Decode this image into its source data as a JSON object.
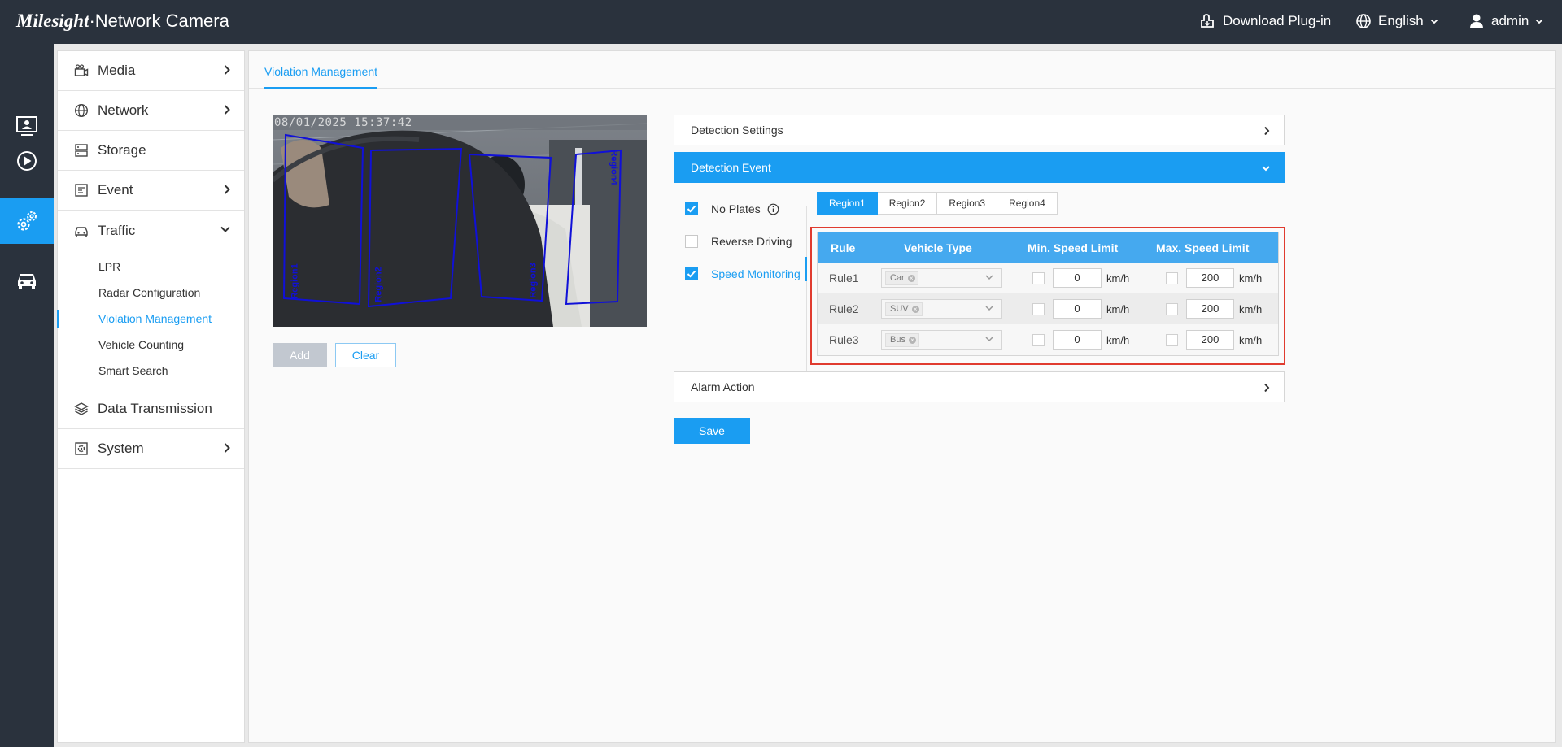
{
  "header": {
    "brand_logo": "Milesight",
    "brand_title": "·Network Camera",
    "download": "Download Plug-in",
    "language": "English",
    "user": "admin"
  },
  "rail": {
    "items": [
      {
        "icon": "live-view-icon"
      },
      {
        "icon": "playback-icon"
      },
      {
        "icon": "settings-icon",
        "active": true
      },
      {
        "icon": "vehicle-search-icon"
      }
    ]
  },
  "menu": {
    "items": [
      {
        "label": "Media",
        "icon": "camera-icon"
      },
      {
        "label": "Network",
        "icon": "globe-icon"
      },
      {
        "label": "Storage",
        "icon": "storage-icon"
      },
      {
        "label": "Event",
        "icon": "event-icon"
      },
      {
        "label": "Traffic",
        "icon": "car-icon"
      },
      {
        "label": "Data Transmission",
        "icon": "layers-icon"
      },
      {
        "label": "System",
        "icon": "system-icon"
      }
    ],
    "traffic_sub": [
      "LPR",
      "Radar Configuration",
      "Violation Management",
      "Vehicle Counting",
      "Smart Search"
    ]
  },
  "tab": {
    "label": "Violation Management"
  },
  "video": {
    "timestamp": "08/01/2025 15:37:42",
    "regions": [
      "Region1",
      "Region2",
      "Region3",
      "Region4"
    ]
  },
  "buttons": {
    "add": "Add",
    "clear": "Clear",
    "save": "Save"
  },
  "panels": {
    "detection_settings": "Detection Settings",
    "detection_event": "Detection Event",
    "alarm_action": "Alarm Action"
  },
  "events": [
    {
      "label": "No Plates",
      "checked": true
    },
    {
      "label": "Reverse Driving",
      "checked": false
    },
    {
      "label": "Speed Monitoring",
      "checked": true
    }
  ],
  "region_tabs": [
    "Region1",
    "Region2",
    "Region3",
    "Region4"
  ],
  "rules": {
    "headers": [
      "Rule",
      "Vehicle Type",
      "Min. Speed Limit",
      "Max. Speed Limit"
    ],
    "unit": "km/h",
    "rows": [
      {
        "rule": "Rule1",
        "vehicle": "Car",
        "min": "0",
        "max": "200"
      },
      {
        "rule": "Rule2",
        "vehicle": "SUV",
        "min": "0",
        "max": "200"
      },
      {
        "rule": "Rule3",
        "vehicle": "Bus",
        "min": "0",
        "max": "200"
      }
    ]
  },
  "colors": {
    "accent": "#1a9df2",
    "header_bg": "#2a323d",
    "highlight_frame": "#e03b2f",
    "region_line": "#1010d8"
  }
}
